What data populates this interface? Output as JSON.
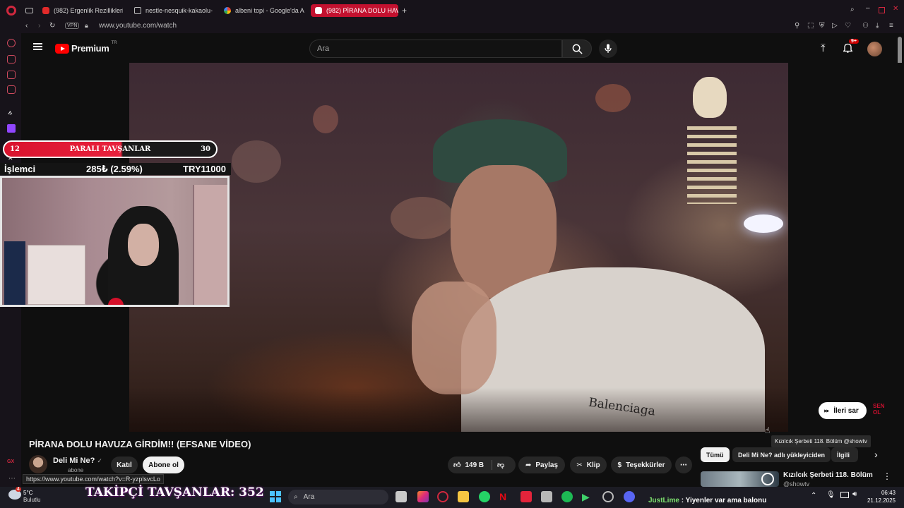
{
  "browser": {
    "tabs": [
      {
        "label": "(982) Ergenlik Rezillikleri",
        "icon": "youtube-icon"
      },
      {
        "label": "nestle-nesquik-kakaolu-",
        "icon": "document-icon"
      },
      {
        "label": "albeni topi - Google'da A",
        "icon": "google-icon"
      },
      {
        "label": "(982) PİRANA DOLU HAV",
        "icon": "youtube-icon",
        "active": true
      }
    ],
    "vpn_label": "VPN",
    "url": "www.youtube.com/watch",
    "accent_color": "#c3112f"
  },
  "youtube": {
    "brand": "Premium",
    "brand_suffix": "TR",
    "search_placeholder": "Ara",
    "notification_badge": "9+",
    "skip_label": "İleri sar"
  },
  "overlay": {
    "bar_left": "12",
    "bar_title": "PARALI TAVŞANLAR",
    "bar_right": "30",
    "stock_name": "İşlemci",
    "stock_change": "285₺ (2.59%)",
    "stock_price": "TRY11000"
  },
  "video": {
    "title": "PİRANA DOLU HAVUZA GİRDİM!! (EFSANE VİDEO)",
    "channel": "Deli Mi Ne?",
    "subscribers_partial": "abone",
    "join_label": "Katıl",
    "subscribe_label": "Abone ol",
    "likes": "149 B",
    "share_label": "Paylaş",
    "clip_label": "Klip",
    "thanks_label": "Teşekkürler",
    "link_preview": "https://www.youtube.com/watch?v=R-yzplsvcLo"
  },
  "sidebar_right": {
    "tooltip": "Kızılcık Şerbeti 118. Bölüm @showtv",
    "chips": [
      "Tümü",
      "Deli Mi Ne? adlı yükleyiciden",
      "İlgili"
    ],
    "rec_title": "Kızılcık Şerbeti 118. Bölüm",
    "rec_channel": "@showtv"
  },
  "taskbar": {
    "weather_temp": "5°C",
    "weather_desc": "Bulutlu",
    "weather_badge": "4",
    "followers_text": "TAKİPÇİ TAVŞANLAR: 352",
    "search_label": "Ara",
    "chat_user": "JustLime",
    "chat_message": "Yiyenler var ama balonu",
    "time": "06:43",
    "date": "21.12.2025"
  }
}
